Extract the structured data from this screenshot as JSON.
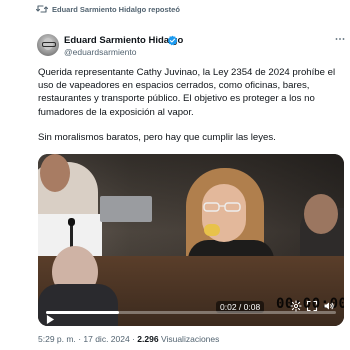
{
  "repost": {
    "text": "Eduard Sarmiento Hidalgo reposteó",
    "icon": "repost-icon"
  },
  "tweet": {
    "author_name": "Eduard Sarmiento Hidalgo",
    "author_handle": "@eduardsarmiento",
    "verified": true,
    "paragraphs": [
      "Querida representante Cathy Juvinao, la Ley 2354 de 2024 prohíbe el uso de vapeadores en espacios cerrados, como oficinas, bares, restaurantes y transporte público. El objetivo es proteger a los no fumadores de la exposición al vapor.",
      "Sin moralismos baratos, pero hay que cumplir las leyes."
    ]
  },
  "video": {
    "watermark": "00:00:00",
    "elapsed": "0:02",
    "duration": "0:08",
    "time_display": "0:02 / 0:08",
    "progress": 0.25
  },
  "footer": {
    "time": "5:29 p. m.",
    "date": "17 dic. 2024",
    "views_count": "2.296",
    "views_label": "Visualizaciones"
  },
  "colors": {
    "accent": "#1d9bf0",
    "secondary_text": "#536471",
    "primary_text": "#0f1419"
  }
}
